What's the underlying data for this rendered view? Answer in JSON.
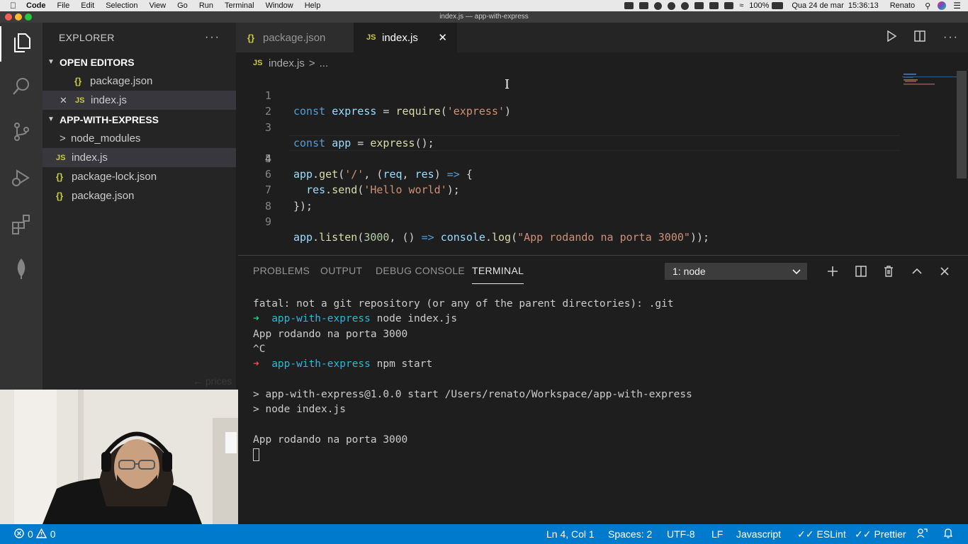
{
  "menubar": {
    "app_name": "Code",
    "items": [
      "File",
      "Edit",
      "Selection",
      "View",
      "Go",
      "Run",
      "Terminal",
      "Window",
      "Help"
    ],
    "battery": "100%",
    "datetime": "Qua 24 de mar  15:36:13",
    "user": "Renato"
  },
  "window": {
    "title": "index.js — app-with-express"
  },
  "activity_bar": {
    "icons": [
      "files-icon",
      "search-icon",
      "source-control-icon",
      "run-debug-icon",
      "extensions-icon",
      "mongodb-leaf-icon"
    ]
  },
  "sidebar": {
    "title": "EXPLORER",
    "more": "···",
    "open_editors": {
      "label": "OPEN EDITORS",
      "items": [
        {
          "name": "package.json",
          "icon": "{}"
        },
        {
          "name": "index.js",
          "icon": "JS",
          "close": "✕"
        }
      ]
    },
    "folder": {
      "label": "APP-WITH-EXPRESS",
      "items": [
        {
          "name": "node_modules",
          "icon": ">"
        },
        {
          "name": "index.js",
          "icon": "JS"
        },
        {
          "name": "package-lock.json",
          "icon": "{}"
        },
        {
          "name": "package.json",
          "icon": "{}"
        }
      ]
    },
    "background_text": "← prices"
  },
  "tabs": [
    {
      "name": "package.json",
      "icon": "{}",
      "active": false
    },
    {
      "name": "index.js",
      "icon": "JS",
      "active": true,
      "close": "✕"
    }
  ],
  "breadcrumb": {
    "icon": "JS",
    "file": "index.js",
    "sep": ">",
    "tail": "..."
  },
  "editor": {
    "current_line": 4,
    "lines": [
      "1",
      "2",
      "3",
      "4",
      "5",
      "6",
      "7",
      "8",
      "9"
    ],
    "code": {
      "l1": {
        "kw": "const",
        "var": "express",
        "op": " = ",
        "fn": "require",
        "open": "(",
        "str": "'express'",
        "close": ")"
      },
      "l3": {
        "kw": "const",
        "var": "app",
        "op": " = ",
        "fn": "express",
        "rest": "();"
      },
      "l5": {
        "obj": "app",
        "dot": ".",
        "fn": "get",
        "open": "(",
        "str": "'/'",
        "comma": ", (",
        "p1": "req",
        "sep": ", ",
        "p2": "res",
        "close": ") ",
        "arrow": "=>",
        "brace": " {"
      },
      "l6": {
        "obj": "res",
        "dot": ".",
        "fn": "send",
        "open": "(",
        "str": "'Hello world'",
        "close": ");"
      },
      "l7": {
        "text": "});"
      },
      "l9": {
        "obj": "app",
        "dot": ".",
        "fn": "listen",
        "open": "(",
        "num": "3000",
        "mid": ", () ",
        "arrow": "=>",
        "sp": " ",
        "obj2": "console",
        "dot2": ".",
        "fn2": "log",
        "open2": "(",
        "str": "\"App rodando na porta 3000\"",
        "close": "));"
      }
    }
  },
  "panel": {
    "tabs": [
      "PROBLEMS",
      "OUTPUT",
      "DEBUG CONSOLE",
      "TERMINAL"
    ],
    "active_tab": "TERMINAL",
    "terminal_select": "1: node",
    "terminal": {
      "l1": "fatal: not a git repository (or any of the parent directories): .git",
      "arrow": "➜",
      "dir": "app-with-express",
      "cmd1": "node index.js",
      "l3": "App rodando na porta 3000",
      "l4": "^C",
      "cmd2": "npm start",
      "l7": "> app-with-express@1.0.0 start /Users/renato/Workspace/app-with-express",
      "l8": "> node index.js",
      "l10": "App rodando na porta 3000"
    }
  },
  "statusbar": {
    "errors": "0",
    "warnings": "0",
    "position": "Ln 4, Col 1",
    "spaces": "Spaces: 2",
    "encoding": "UTF-8",
    "eol": "LF",
    "language": "Javascript",
    "eslint": "ESLint",
    "prettier": "Prettier"
  },
  "colors": {
    "statusbar": "#007acc",
    "activity_bar": "#333333",
    "sidebar": "#252526",
    "editor": "#1e1e1e",
    "keyword": "#569cd6",
    "string": "#ce9178",
    "function": "#dcdcaa",
    "variable": "#9cdcfe",
    "js_icon": "#cbcb41"
  }
}
